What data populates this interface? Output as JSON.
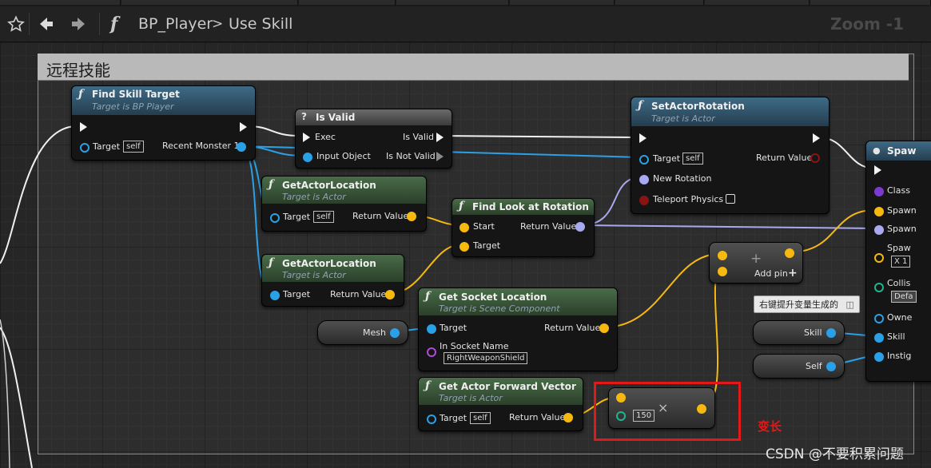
{
  "toolbar": {
    "breadcrumb_function_symbol": "f",
    "breadcrumb_owner": "BP_Player",
    "breadcrumb_separator": ">",
    "breadcrumb_current": "Use Skill",
    "zoom": "Zoom -1"
  },
  "comment": {
    "title": "远程技能"
  },
  "nodes": {
    "find_skill_target": {
      "title": "Find Skill Target",
      "subtitle": "Target is BP Player",
      "target_label": "Target",
      "target_value": "self",
      "output_label": "Recent Monster 1"
    },
    "is_valid": {
      "title": "Is Valid",
      "exec_label": "Exec",
      "input_label": "Input Object",
      "valid_label": "Is Valid",
      "not_valid_label": "Is Not Valid"
    },
    "set_actor_rotation": {
      "title": "SetActorRotation",
      "subtitle": "Target is Actor",
      "target_label": "Target",
      "target_value": "self",
      "new_rotation_label": "New Rotation",
      "teleport_label": "Teleport Physics",
      "return_label": "Return Value"
    },
    "get_actor_location_1": {
      "title": "GetActorLocation",
      "subtitle": "Target is Actor",
      "target_label": "Target",
      "target_value": "self",
      "return_label": "Return Value"
    },
    "get_actor_location_2": {
      "title": "GetActorLocation",
      "subtitle": "Target is Actor",
      "target_label": "Target",
      "return_label": "Return Value"
    },
    "find_look_at_rotation": {
      "title": "Find Look at Rotation",
      "start_label": "Start",
      "target_label": "Target",
      "return_label": "Return Value"
    },
    "get_socket_location": {
      "title": "Get Socket Location",
      "subtitle": "Target is Scene Component",
      "target_label": "Target",
      "socket_label": "In Socket Name",
      "socket_value": "RightWeaponShield",
      "return_label": "Return Value"
    },
    "get_actor_forward_vector": {
      "title": "Get Actor Forward Vector",
      "subtitle": "Target is Actor",
      "target_label": "Target",
      "target_value": "self",
      "return_label": "Return Value"
    },
    "add_node": {
      "symbol": "+",
      "add_pin_label": "Add pin"
    },
    "multiply_node": {
      "symbol": "×",
      "value": "150"
    },
    "spawn": {
      "title": "Spaw",
      "pins": [
        "Class",
        "Spawn",
        "Spawn",
        "Spaw",
        "Collis",
        "Owne",
        "Skill",
        "Instig"
      ],
      "transform_value": "X 1",
      "default_value": "Defa"
    },
    "mesh_var": {
      "label": "Mesh"
    },
    "skill_var": {
      "label": "Skill"
    },
    "self_var": {
      "label": "Self"
    }
  },
  "tooltip": {
    "text": "右键提升变量生成的"
  },
  "annotation": {
    "text": "变长"
  },
  "watermark": {
    "text": "CSDN @不要积累问题"
  }
}
